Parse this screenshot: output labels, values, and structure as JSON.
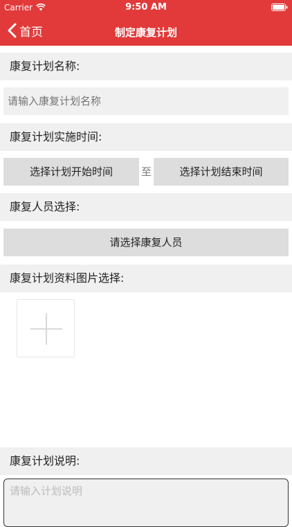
{
  "status_bar": {
    "carrier": "Carrier",
    "time": "9:50 AM"
  },
  "nav": {
    "back_label": "首页",
    "title": "制定康复计划"
  },
  "form": {
    "name_label": "康复计划名称:",
    "name_placeholder": "请输入康复计划名称",
    "time_label": "康复计划实施时间:",
    "start_button": "选择计划开始时间",
    "to_label": "至",
    "end_button": "选择计划结束时间",
    "staff_label": "康复人员选择:",
    "staff_button": "请选择康复人员",
    "images_label": "康复计划资料图片选择:",
    "desc_label": "康复计划说明:",
    "desc_placeholder": "请输入计划说明"
  },
  "colors": {
    "accent": "#e23a3a",
    "section_bg": "#f0f0f0",
    "button_bg": "#dddddd"
  },
  "icons": {
    "back": "chevron-left-icon",
    "wifi": "wifi-icon",
    "battery": "battery-icon",
    "add": "plus-icon"
  }
}
